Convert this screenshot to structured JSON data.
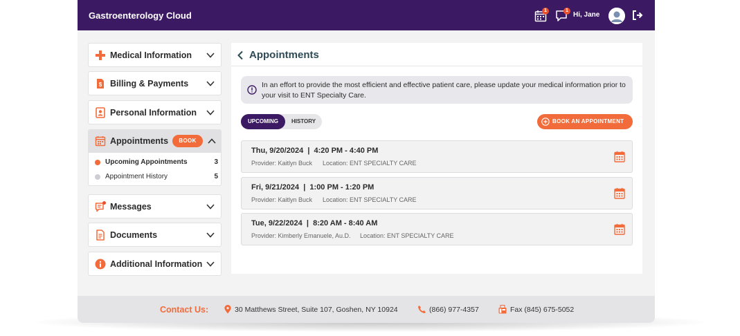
{
  "app": {
    "title": "Gastroenterology Cloud"
  },
  "topbar": {
    "calendar_badge": "1",
    "messages_badge": "1",
    "greeting": "Hi, Jane"
  },
  "sidebar": {
    "items": [
      {
        "label": "Medical Information",
        "icon": "medical-cross-icon"
      },
      {
        "label": "Billing & Payments",
        "icon": "invoice-icon"
      },
      {
        "label": "Personal Information",
        "icon": "id-card-icon"
      },
      {
        "label": "Appointments",
        "icon": "calendar-icon",
        "book_label": "BOOK",
        "sub_items": [
          {
            "label": "Upcoming Appointments",
            "count": "3",
            "active": true
          },
          {
            "label": "Appointment History",
            "count": "5",
            "active": false
          }
        ]
      },
      {
        "label": "Messages",
        "icon": "message-icon"
      },
      {
        "label": "Documents",
        "icon": "document-icon"
      },
      {
        "label": "Additional Information",
        "icon": "info-icon"
      }
    ]
  },
  "main": {
    "title": "Appointments",
    "notice": "In an effort to provide the most efficient and effective patient care, please update your medical information prior to your visit to ENT Specialty Care.",
    "tabs": {
      "upcoming": "UPCOMING",
      "history": "HISTORY"
    },
    "book_button": "BOOK AN APPOINTMENT",
    "appointments": [
      {
        "when": "Thu, 9/20/2024  |  4:20 PM - 4:40 PM",
        "provider": "Provider: Kaitlyn Buck",
        "location": "Location: ENT SPECIALTY CARE"
      },
      {
        "when": "Fri, 9/21/2024  |  1:00 PM - 1:20 PM",
        "provider": "Provider: Kaitlyn Buck",
        "location": "Location: ENT SPECIALTY CARE"
      },
      {
        "when": "Tue, 9/22/2024  |  8:20 AM - 8:40 AM",
        "provider": "Provider: Kimberly Emanuele, Au.D.",
        "location": "Location: ENT SPECIALTY CARE"
      }
    ]
  },
  "footer": {
    "contact_label": "Contact Us:",
    "address": "30 Matthews Street, Suite 107, Goshen, NY 10924",
    "phone": "(866) 977-4357",
    "fax": "Fax (845) 675-5052"
  },
  "colors": {
    "primary": "#3b1a63",
    "accent": "#f26b3a"
  }
}
